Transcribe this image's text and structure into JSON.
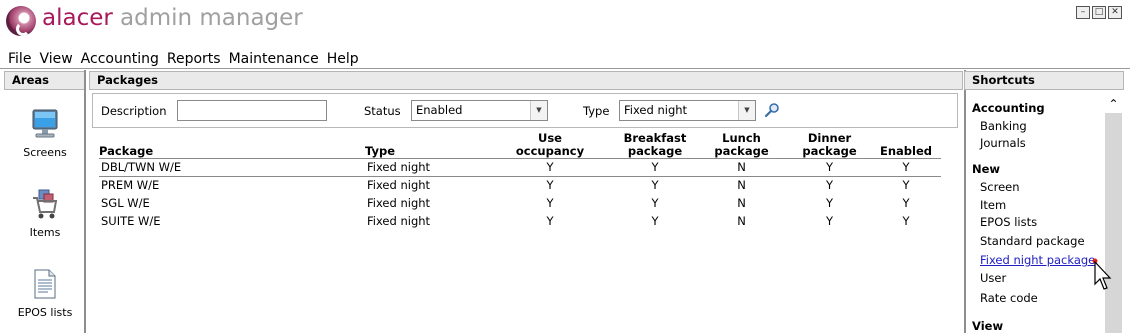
{
  "app": {
    "brand": "alacer",
    "title_rest": "admin manager"
  },
  "window_buttons": {
    "minimize": "–",
    "maximize": "□",
    "close": "✕"
  },
  "menu": [
    "File",
    "View",
    "Accounting",
    "Reports",
    "Maintenance",
    "Help"
  ],
  "areas": {
    "header": "Areas",
    "items": [
      {
        "label": "Screens",
        "icon": "monitor-icon"
      },
      {
        "label": "Items",
        "icon": "cart-icon"
      },
      {
        "label": "EPOS lists",
        "icon": "document-icon"
      }
    ]
  },
  "packages": {
    "header": "Packages",
    "filters": {
      "description_label": "Description",
      "description_value": "",
      "status_label": "Status",
      "status_value": "Enabled",
      "type_label": "Type",
      "type_value": "Fixed night"
    },
    "columns": [
      "Package",
      "Type",
      "Use occupancy",
      "Breakfast package",
      "Lunch package",
      "Dinner package",
      "Enabled"
    ],
    "column_lines": [
      [
        "Package"
      ],
      [
        "Type"
      ],
      [
        "Use",
        "occupancy"
      ],
      [
        "Breakfast",
        "package"
      ],
      [
        "Lunch",
        "package"
      ],
      [
        "Dinner",
        "package"
      ],
      [
        "Enabled"
      ]
    ],
    "rows": [
      [
        "DBL/TWN W/E",
        "Fixed night",
        "Y",
        "Y",
        "N",
        "Y",
        "Y"
      ],
      [
        "PREM W/E",
        "Fixed night",
        "Y",
        "Y",
        "N",
        "Y",
        "Y"
      ],
      [
        "SGL W/E",
        "Fixed night",
        "Y",
        "Y",
        "N",
        "Y",
        "Y"
      ],
      [
        "SUITE W/E",
        "Fixed night",
        "Y",
        "Y",
        "N",
        "Y",
        "Y"
      ]
    ]
  },
  "shortcuts": {
    "header": "Shortcuts",
    "accounting_label": "Accounting",
    "accounting_items": [
      "Banking",
      "Journals"
    ],
    "new_label": "New",
    "new_items": [
      "Screen",
      "Item",
      "EPOS lists",
      "Standard package",
      "Fixed night package",
      "User",
      "Rate code"
    ],
    "view_label": "View"
  },
  "colors": {
    "brand": "#a8185a",
    "title_grey": "#a0a0a0",
    "link": "#2020c0",
    "panel_header": "#eaeaea"
  }
}
